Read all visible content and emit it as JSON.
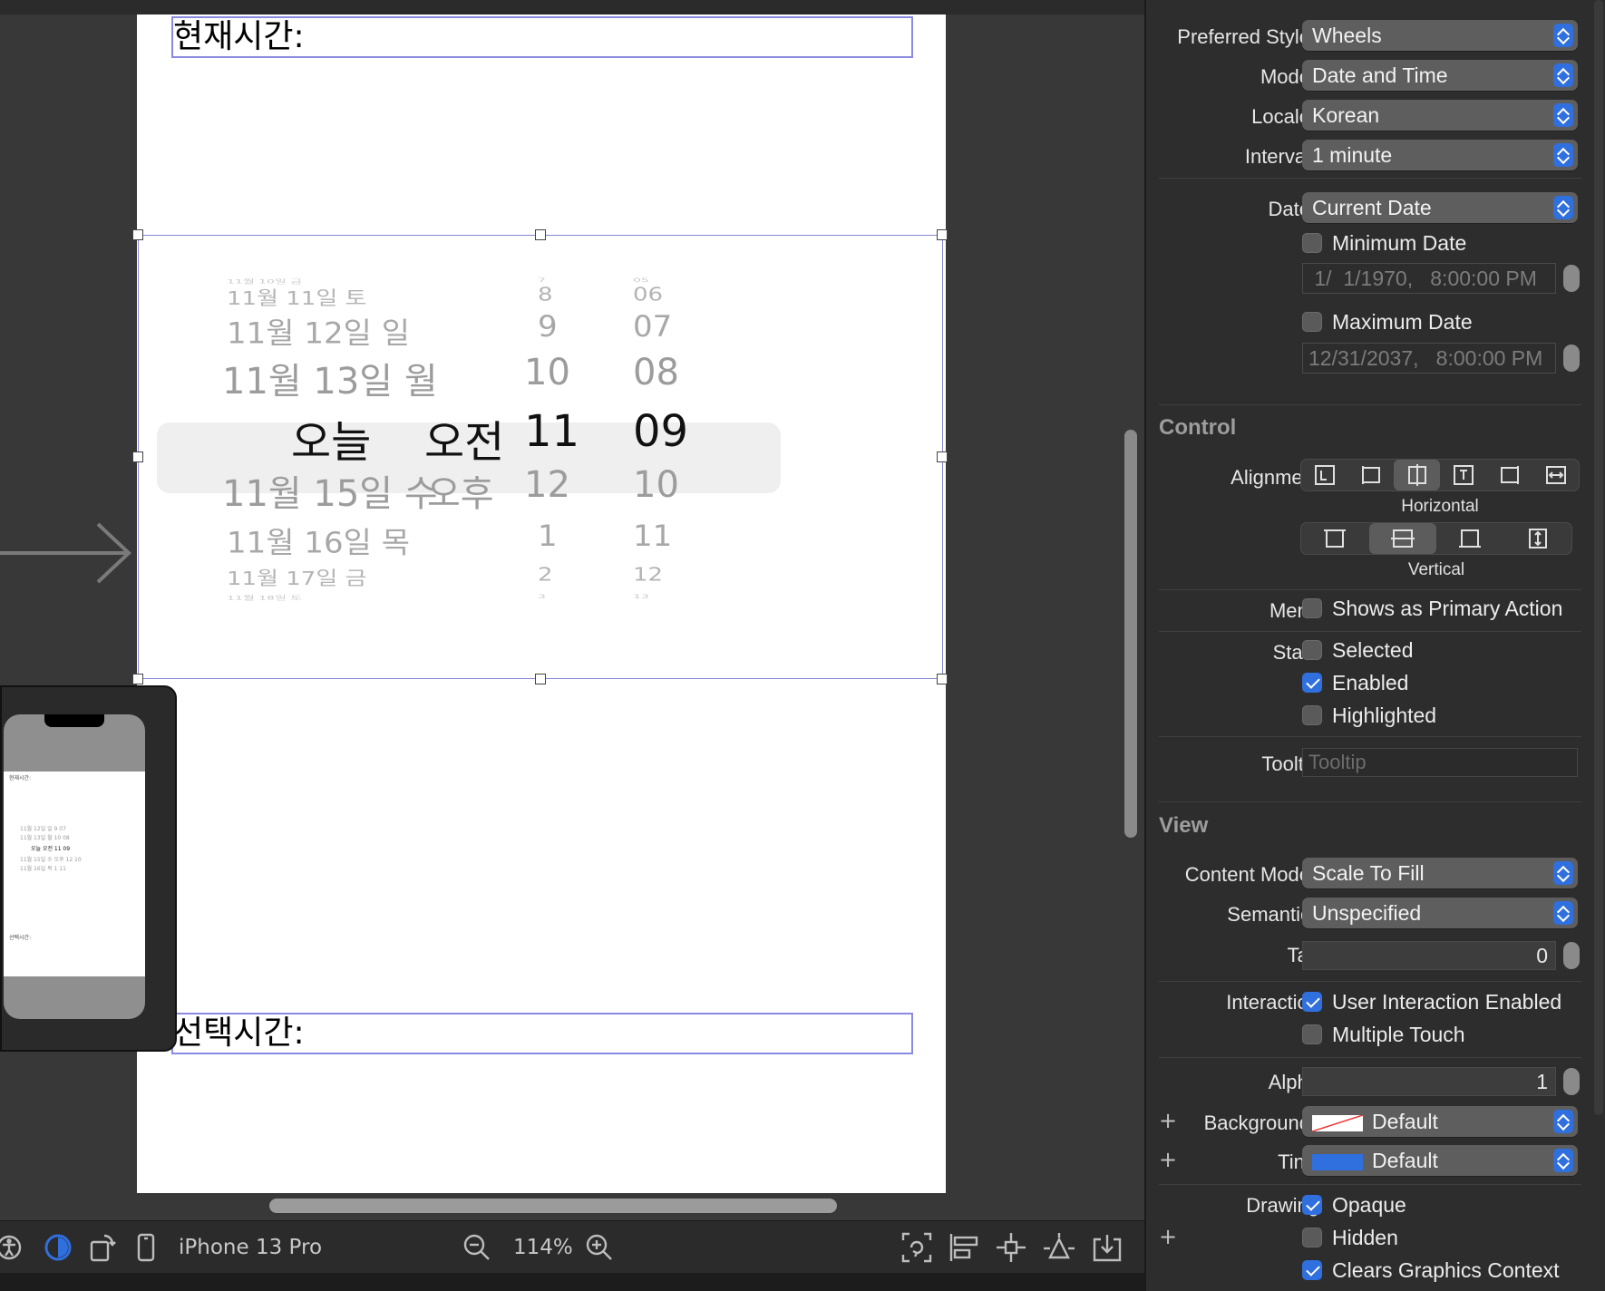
{
  "canvas": {
    "label_current": "현재시간:",
    "label_selected": "선택시간:",
    "picker_rows": [
      {
        "date": "11월 10일 금",
        "ampm": "",
        "hour": "7",
        "minute": "05",
        "style": "edge2"
      },
      {
        "date": "11월 11일 토",
        "ampm": "",
        "hour": "8",
        "minute": "06",
        "style": "edge1"
      },
      {
        "date": "11월 12일 일",
        "ampm": "",
        "hour": "9",
        "minute": "07",
        "style": "near2"
      },
      {
        "date": "11월 13일 월",
        "ampm": "",
        "hour": "10",
        "minute": "08",
        "style": "near1"
      },
      {
        "date": "오늘",
        "ampm": "오전",
        "hour": "11",
        "minute": "09",
        "style": "center"
      },
      {
        "date": "11월 15일 수",
        "ampm": "오후",
        "hour": "12",
        "minute": "10",
        "style": "near1"
      },
      {
        "date": "11월 16일 목",
        "ampm": "",
        "hour": "1",
        "minute": "11",
        "style": "near2"
      },
      {
        "date": "11월 17일 금",
        "ampm": "",
        "hour": "2",
        "minute": "12",
        "style": "edge1"
      },
      {
        "date": "11월 18일 토",
        "ampm": "",
        "hour": "3",
        "minute": "13",
        "style": "edge2"
      }
    ],
    "minimap_lines": [
      "현재시간:",
      "11월 12일 일   9  07",
      "11월 13일 월  10  08",
      "오늘  오전  11  09",
      "11월 15일 수 오후 12 10",
      "11월 16일 목  1  11",
      "선택시간:"
    ]
  },
  "bottombar": {
    "device": "iPhone 13 Pro",
    "zoom": "114%",
    "icons": [
      "accessibility-icon",
      "appearance-icon",
      "orientation-icon",
      "device-icon",
      "zoom-out-icon",
      "zoom-in-icon",
      "update-frames-icon",
      "align-icon",
      "add-constraints-icon",
      "resolve-issues-icon",
      "embed-in-icon"
    ]
  },
  "inspector": {
    "preferred_style": {
      "label": "Preferred Style",
      "value": "Wheels"
    },
    "mode": {
      "label": "Mode",
      "value": "Date and Time"
    },
    "locale": {
      "label": "Locale",
      "value": "Korean"
    },
    "interval": {
      "label": "Interval",
      "value": "1 minute"
    },
    "date": {
      "label": "Date",
      "value": "Current Date"
    },
    "minimum_date": {
      "label": "Minimum Date",
      "checked": false,
      "value": " 1/  1/1970,   8:00:00 PM"
    },
    "maximum_date": {
      "label": "Maximum Date",
      "checked": false,
      "value": "12/31/2037,   8:00:00 PM"
    },
    "control_section": "Control",
    "alignment_label": "Alignment",
    "horizontal_caption": "Horizontal",
    "vertical_caption": "Vertical",
    "menu": {
      "label": "Menu",
      "option": "Shows as Primary Action",
      "checked": false
    },
    "state": {
      "label": "State",
      "selected": "Selected",
      "enabled": "Enabled",
      "highlighted": "Highlighted"
    },
    "tooltip": {
      "label": "Tooltip",
      "placeholder": "Tooltip"
    },
    "view_section": "View",
    "content_mode": {
      "label": "Content Mode",
      "value": "Scale To Fill"
    },
    "semantic": {
      "label": "Semantic",
      "value": "Unspecified"
    },
    "tag": {
      "label": "Tag",
      "value": "0"
    },
    "interaction": {
      "label": "Interaction",
      "user_interaction": "User Interaction Enabled",
      "multiple_touch": "Multiple Touch"
    },
    "alpha": {
      "label": "Alpha",
      "value": "1"
    },
    "background": {
      "label": "Background",
      "value": "Default"
    },
    "tint": {
      "label": "Tint",
      "value": "Default",
      "color": "#2f6fde"
    },
    "drawing": {
      "label": "Drawing",
      "opaque": "Opaque",
      "hidden": "Hidden",
      "clears": "Clears Graphics Context"
    }
  },
  "colors": {
    "accent": "#2f6fde",
    "selection_outline": "#8585d6"
  }
}
